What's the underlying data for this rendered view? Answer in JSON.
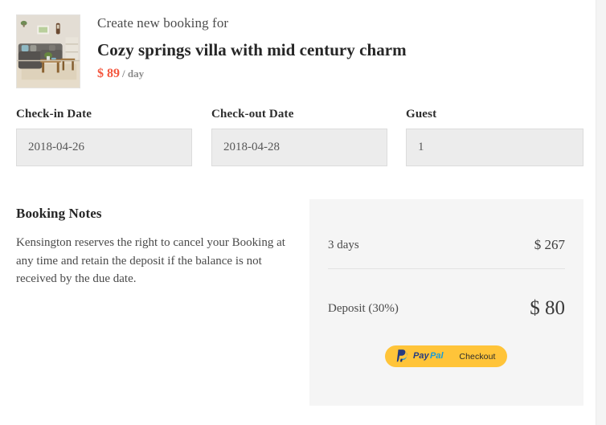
{
  "header": {
    "kicker": "Create new booking for",
    "listing_title": "Cozy springs villa with mid century charm",
    "price_amount": "$ 89",
    "price_unit": "/ day",
    "price_color": "#f4573f",
    "thumbnail_alt": "living-room-photo"
  },
  "form": {
    "fields": [
      {
        "label": "Check-in Date",
        "value": "2018-04-26",
        "placeholder": "2018-04-26",
        "name": "check-in-date"
      },
      {
        "label": "Check-out Date",
        "value": "2018-04-28",
        "placeholder": "2018-04-28",
        "name": "check-out-date"
      },
      {
        "label": "Guest",
        "value": "1",
        "placeholder": "1",
        "name": "guest-count"
      }
    ]
  },
  "notes": {
    "heading": "Booking Notes",
    "body": "Kensington reserves the right to cancel your Booking at any time and retain the deposit if the balance is not received by the due date."
  },
  "summary": {
    "background": "#f5f5f5",
    "rows": [
      {
        "label": "3 days",
        "value": "$ 267"
      },
      {
        "label": "Deposit (30%)",
        "value": "$ 80"
      }
    ],
    "paypal": {
      "wordmark": "PayPal",
      "checkout_label": "Checkout",
      "button_color": "#ffc439",
      "mark_dark": "#253b80",
      "mark_light": "#179bd7"
    }
  }
}
